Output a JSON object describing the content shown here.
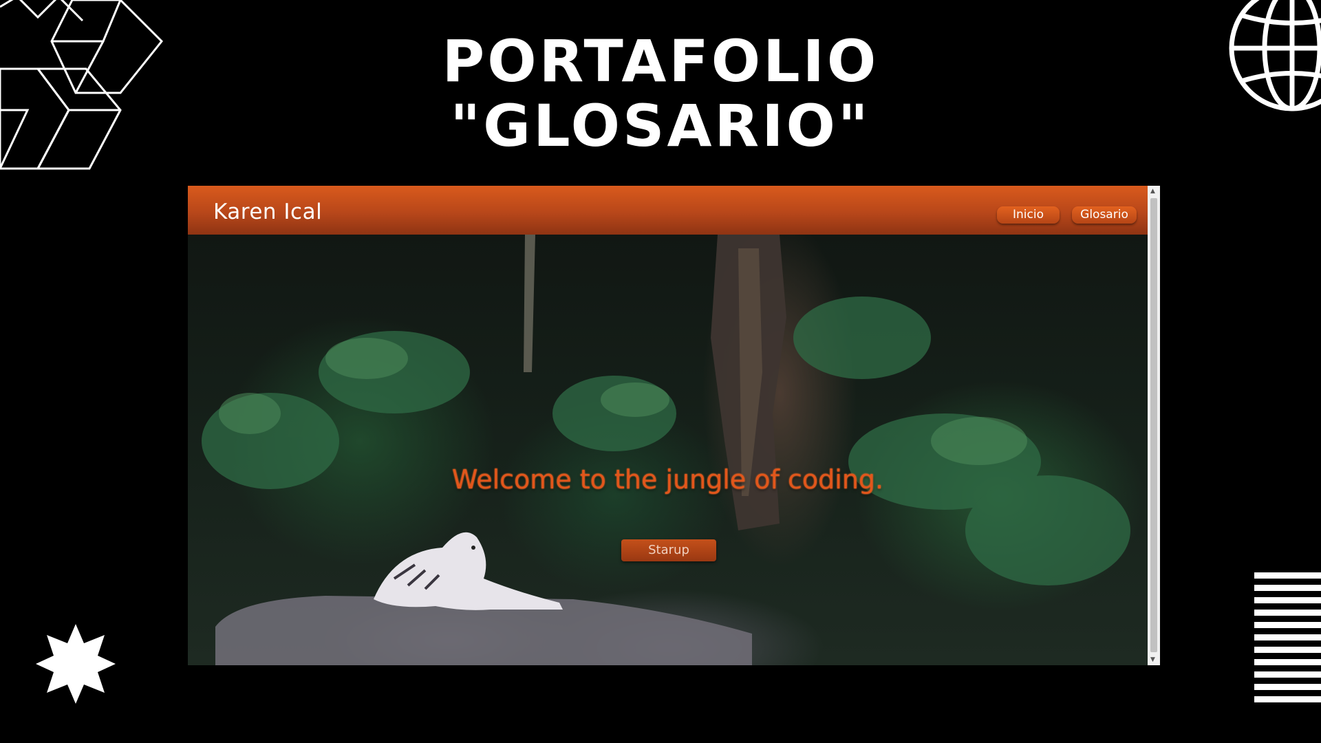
{
  "slide": {
    "title_line1": "PORTAFOLIO",
    "title_line2": "\"GLOSARIO\""
  },
  "website": {
    "brand": "Karen Ical",
    "nav": [
      {
        "label": "Inicio"
      },
      {
        "label": "Glosario"
      }
    ],
    "hero": {
      "heading": "Welcome to the jungle of coding.",
      "button_label": "Starup"
    }
  },
  "colors": {
    "background": "#000000",
    "accent": "#d95a1c",
    "text": "#ffffff"
  },
  "icons": [
    "hexagon-cubes-icon",
    "globe-icon",
    "star-burst-icon",
    "striped-lines-icon"
  ]
}
